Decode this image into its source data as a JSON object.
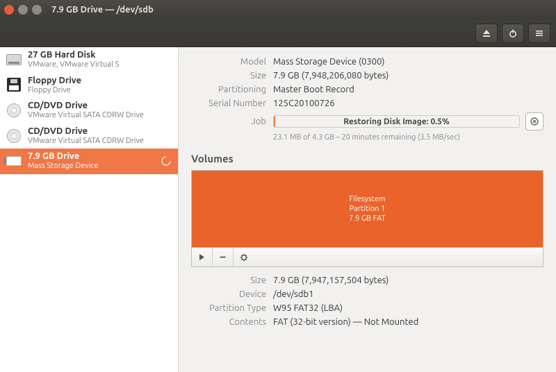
{
  "window": {
    "title": "7.9 GB Drive — /dev/sdb"
  },
  "sidebar": {
    "items": [
      {
        "name": "27 GB Hard Disk",
        "sub": "VMware, VMware Virtual S",
        "icon": "hdd"
      },
      {
        "name": "Floppy Drive",
        "sub": "Floppy Drive",
        "icon": "floppy"
      },
      {
        "name": "CD/DVD Drive",
        "sub": "VMware Virtual SATA CDRW Drive",
        "icon": "cd"
      },
      {
        "name": "CD/DVD Drive",
        "sub": "VMware Virtual SATA CDRW Drive",
        "icon": "cd"
      },
      {
        "name": "7.9 GB Drive",
        "sub": "Mass Storage Device",
        "icon": "usb"
      }
    ]
  },
  "details": {
    "model_label": "Model",
    "model": "Mass Storage Device (0300)",
    "size_label": "Size",
    "size": "7.9 GB (7,948,206,080 bytes)",
    "partitioning_label": "Partitioning",
    "partitioning": "Master Boot Record",
    "serial_label": "Serial Number",
    "serial": "125C20100726",
    "job_label": "Job",
    "job_progress_label": "Restoring Disk Image: 0.5%",
    "job_progress_pct": 0.5,
    "job_detail": "23.1 MB of 4.3 GB – 20 minutes remaining (3.5 MB/sec)"
  },
  "volumes": {
    "section_title": "Volumes",
    "partition": {
      "line1": "Filesystem",
      "line2": "Partition 1",
      "line3": "7.9 GB FAT"
    },
    "props": {
      "size_label": "Size",
      "size": "7.9 GB (7,947,157,504 bytes)",
      "device_label": "Device",
      "device": "/dev/sdb1",
      "ptype_label": "Partition Type",
      "ptype": "W95 FAT32 (LBA)",
      "contents_label": "Contents",
      "contents": "FAT (32-bit version) — Not Mounted"
    }
  },
  "colors": {
    "accent": "#f07746",
    "volume": "#e9632a"
  }
}
